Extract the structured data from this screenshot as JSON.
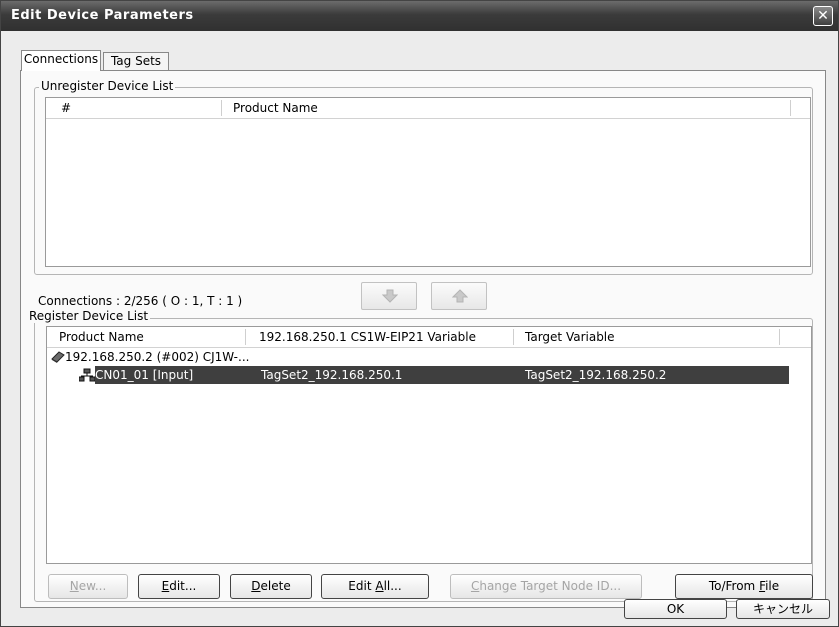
{
  "window": {
    "title": "Edit Device Parameters"
  },
  "tabs": [
    {
      "label": "Connections",
      "active": true
    },
    {
      "label": "Tag Sets",
      "active": false
    }
  ],
  "unregister": {
    "group_label": "Unregister Device List",
    "columns": [
      "#",
      "Product Name"
    ]
  },
  "connections_status": "Connections :  2/256 ( O : 1, T : 1 )",
  "move_buttons": {
    "down_icon": "arrow-down-icon",
    "up_icon": "arrow-up-icon"
  },
  "register": {
    "group_label": "Register Device List",
    "columns": [
      "Product Name",
      "192.168.250.1 CS1W-EIP21 Variable",
      "Target Variable"
    ],
    "device_row": {
      "icon": "device-icon",
      "label": "192.168.250.2 (#002) CJ1W-..."
    },
    "connection_row": {
      "icon": "network-connection-icon",
      "name": "CN01_01 [Input]",
      "originator_variable": "TagSet2_192.168.250.1",
      "target_variable": "TagSet2_192.168.250.2",
      "selected": true
    }
  },
  "buttons": {
    "new": {
      "label": "New...",
      "mnemonic": "N",
      "enabled": false
    },
    "edit": {
      "label": "Edit...",
      "mnemonic": "E",
      "enabled": true
    },
    "delete": {
      "label": "Delete",
      "mnemonic": "D",
      "enabled": true
    },
    "edit_all": {
      "label": "Edit All...",
      "mnemonic": "A",
      "enabled": true
    },
    "change_target": {
      "label": "Change Target Node ID...",
      "mnemonic": "C",
      "enabled": false
    },
    "to_from_file": {
      "label": "To/From File",
      "mnemonic": "F",
      "enabled": true
    }
  },
  "dialog_buttons": {
    "ok": "OK",
    "cancel": "キャンセル"
  }
}
